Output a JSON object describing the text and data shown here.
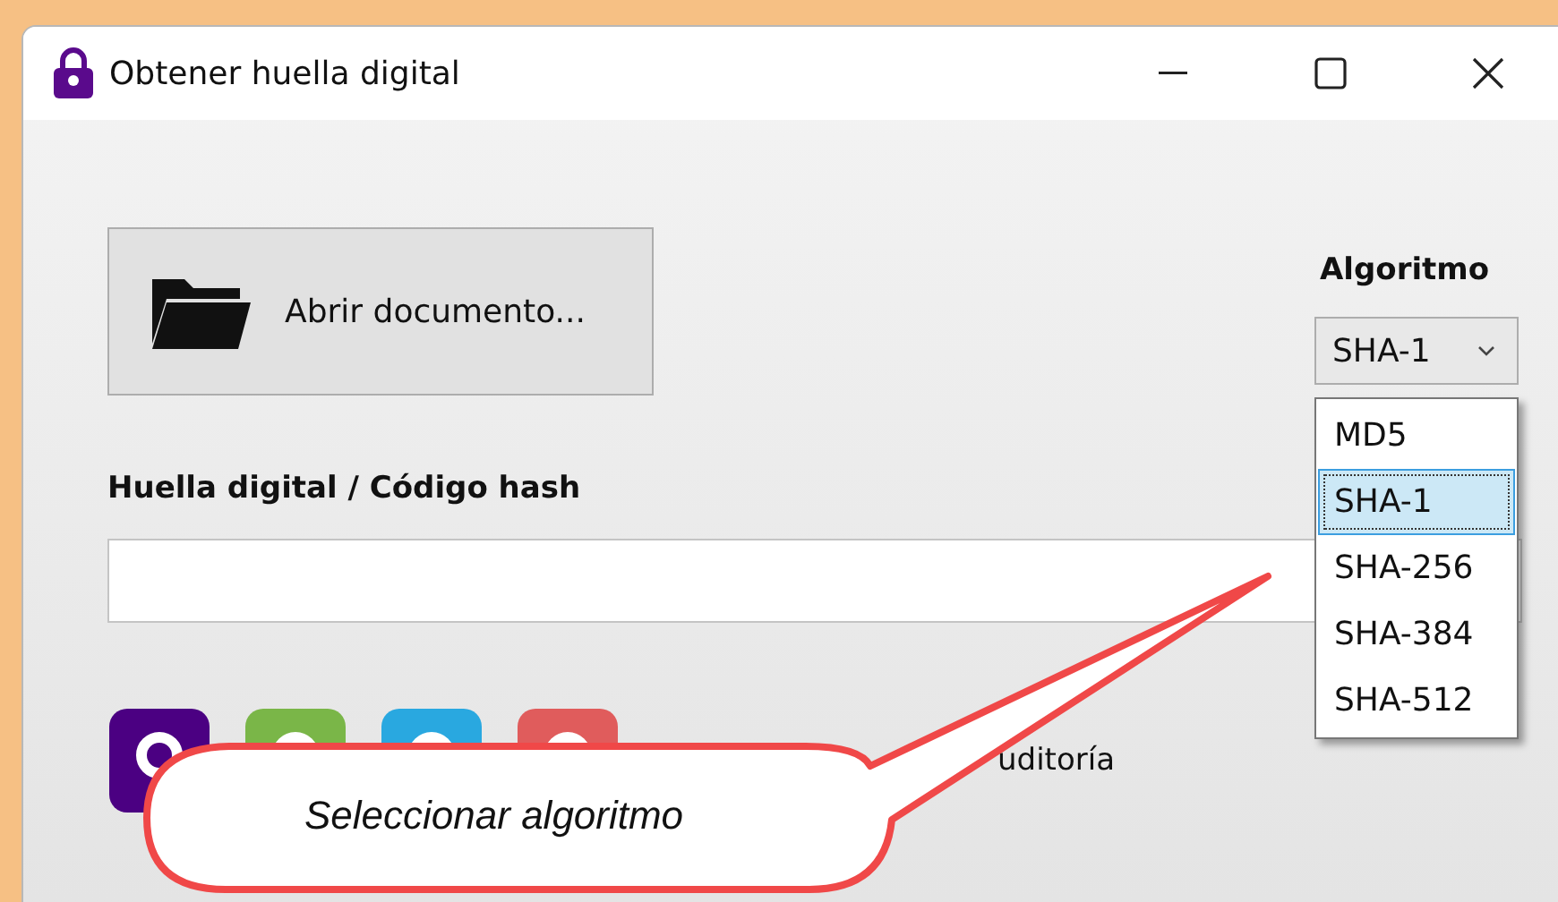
{
  "window": {
    "title": "Obtener huella digital"
  },
  "open_button": {
    "label": "Abrir documento..."
  },
  "algorithm": {
    "label": "Algoritmo",
    "value": "SHA-1",
    "expanded": true,
    "options": [
      {
        "label": "MD5",
        "selected": false
      },
      {
        "label": "SHA-1",
        "selected": true
      },
      {
        "label": "SHA-256",
        "selected": false
      },
      {
        "label": "SHA-384",
        "selected": false
      },
      {
        "label": "SHA-512",
        "selected": false
      }
    ]
  },
  "hash": {
    "label": "Huella digital / Código hash"
  },
  "footer": {
    "text": "uditoría"
  },
  "callout": {
    "text": "Seleccionar algoritmo"
  }
}
